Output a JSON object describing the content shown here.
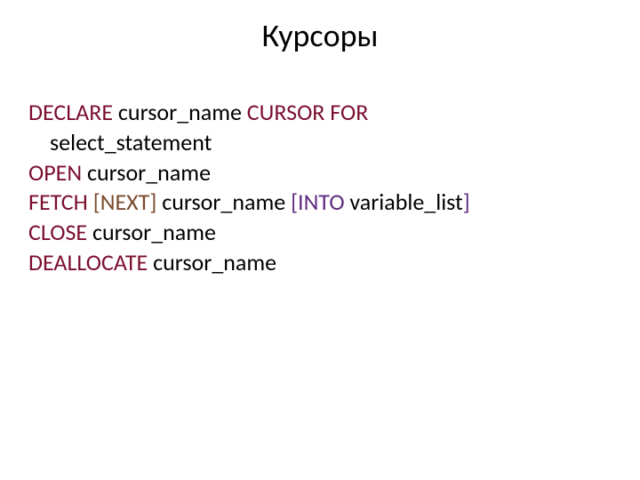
{
  "title": "Курсоры",
  "lines": {
    "l1": {
      "kw1": "DECLARE ",
      "id1": "cursor_name",
      "kw2": " CURSOR FOR"
    },
    "l2": {
      "id1": "select_statement"
    },
    "l3": {
      "kw1": "OPEN ",
      "id1": "cursor_name"
    },
    "l4": {
      "kw1": "FETCH",
      "opt1": " [NEXT] ",
      "id1": "cursor_name",
      "opt2": " [INTO ",
      "id2": "variable_list",
      "close": "]"
    },
    "l5": {
      "kw1": "CLOSE ",
      "id1": "cursor_name"
    },
    "l6": {
      "kw1": "DEALLOCATE ",
      "id1": "cursor_name"
    }
  }
}
